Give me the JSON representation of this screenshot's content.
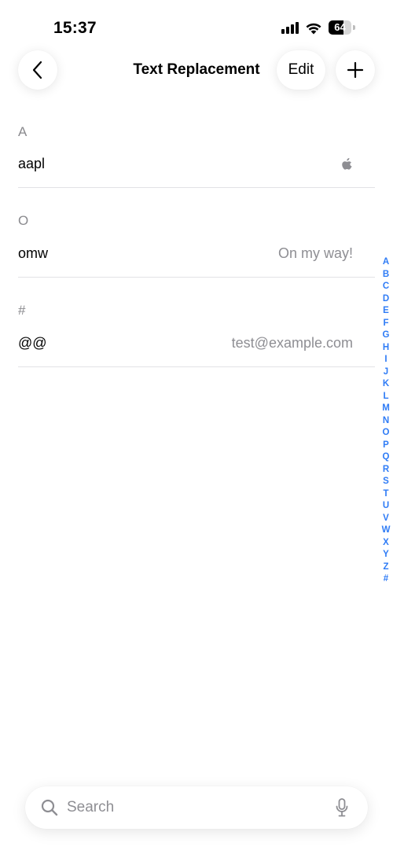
{
  "status_bar": {
    "time": "15:37",
    "battery_percent": "64",
    "battery_level": 0.64,
    "signal_bars": 4
  },
  "nav": {
    "title": "Text Replacement",
    "edit_label": "Edit",
    "back_icon": "chevron-left-icon",
    "add_icon": "plus-icon"
  },
  "sections": [
    {
      "header": "A",
      "rows": [
        {
          "shortcut": "aapl",
          "phrase_icon": "apple-logo-icon"
        }
      ]
    },
    {
      "header": "O",
      "rows": [
        {
          "shortcut": "omw",
          "phrase": "On my way!"
        }
      ]
    },
    {
      "header": "#",
      "rows": [
        {
          "shortcut": "@@",
          "phrase": "test@example.com"
        }
      ]
    }
  ],
  "index_letters": [
    "A",
    "B",
    "C",
    "D",
    "E",
    "F",
    "G",
    "H",
    "I",
    "J",
    "K",
    "L",
    "M",
    "N",
    "O",
    "P",
    "Q",
    "R",
    "S",
    "T",
    "U",
    "V",
    "W",
    "X",
    "Y",
    "Z",
    "#"
  ],
  "search": {
    "placeholder": "Search",
    "search_icon": "search-icon",
    "mic_icon": "mic-icon"
  },
  "colors": {
    "accent": "#2f7cf6",
    "secondary_text": "#8e8e93",
    "separator": "#e2e2e6"
  }
}
